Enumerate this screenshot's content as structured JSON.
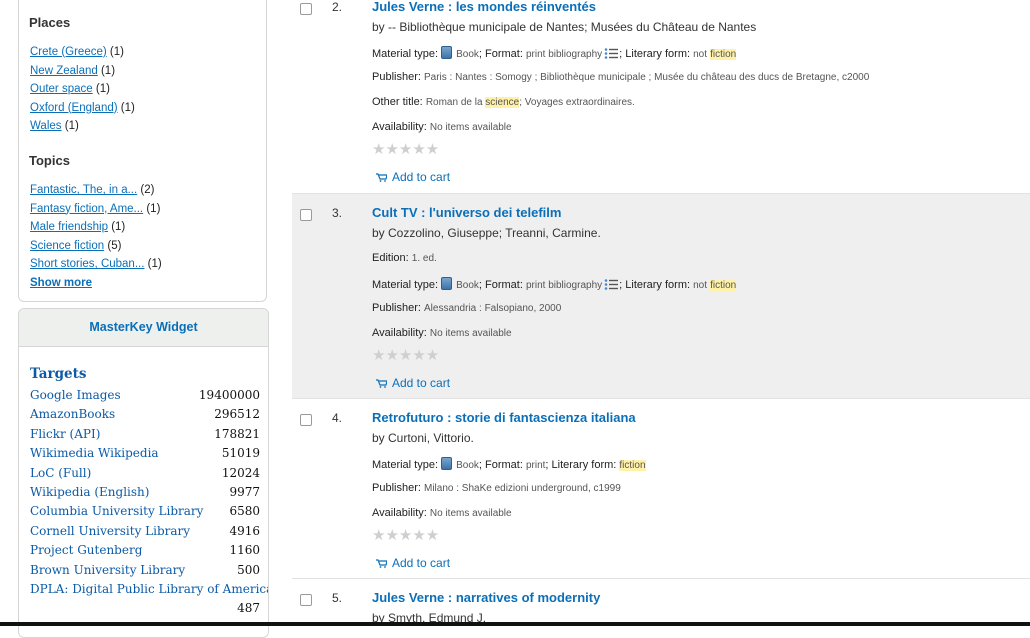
{
  "facets": {
    "places": {
      "title": "Places",
      "items": [
        {
          "label": "Crete (Greece)",
          "count": "(1)"
        },
        {
          "label": "New Zealand",
          "count": "(1)"
        },
        {
          "label": "Outer space",
          "count": "(1)"
        },
        {
          "label": "Oxford (England)",
          "count": "(1)"
        },
        {
          "label": "Wales",
          "count": "(1)"
        }
      ]
    },
    "topics": {
      "title": "Topics",
      "items": [
        {
          "label": "Fantastic, The, in a...",
          "count": "(2)"
        },
        {
          "label": "Fantasy fiction, Ame...",
          "count": "(1)"
        },
        {
          "label": "Male friendship",
          "count": "(1)"
        },
        {
          "label": "Science fiction",
          "count": "(5)"
        },
        {
          "label": "Short stories, Cuban...",
          "count": "(1)"
        }
      ],
      "show_more": "Show more"
    }
  },
  "masterkey": {
    "title": "MasterKey Widget",
    "targets_title": "Targets",
    "targets": [
      {
        "name": "Google Images",
        "count": "19400000"
      },
      {
        "name": "AmazonBooks",
        "count": "296512"
      },
      {
        "name": "Flickr (API)",
        "count": "178821"
      },
      {
        "name": "Wikimedia Wikipedia",
        "count": "51019"
      },
      {
        "name": "LoC (Full)",
        "count": "12024"
      },
      {
        "name": "Wikipedia (English)",
        "count": "9977"
      },
      {
        "name": "Columbia University Library",
        "count": "6580"
      },
      {
        "name": "Cornell University Library",
        "count": "4916"
      },
      {
        "name": "Project Gutenberg",
        "count": "1160"
      },
      {
        "name": "Brown University Library",
        "count": "500"
      },
      {
        "name": "DPLA: Digital Public Library of America",
        "count": "487"
      }
    ]
  },
  "labels": {
    "material_type": "Material type:",
    "book": "Book",
    "format": "; Format:",
    "literary_form": "; Literary form:",
    "publisher": "Publisher:",
    "other_title": "Other title:",
    "availability": "Availability:",
    "edition": "Edition:",
    "add_to_cart": "Add to cart",
    "not": "not",
    "stars": "★★★★★"
  },
  "results": [
    {
      "num": "2.",
      "title": "Jules Verne : les mondes réinventés",
      "by": "by -- Bibliothèque municipale de Nantes; Musées du Château de Nantes",
      "format": "print bibliography",
      "form_not": "not",
      "form": "fiction",
      "publisher": "Paris : Nantes : Somogy ; Bibliothèque municipale ; Musée du château des ducs de Bretagne, c2000",
      "other_title_pre": "Roman de la ",
      "other_title_hl": "science",
      "other_title_post": "; Voyages extraordinaires.",
      "availability": "No items available"
    },
    {
      "num": "3.",
      "title": "Cult TV : l'universo dei telefilm",
      "by": "by Cozzolino, Giuseppe; Treanni, Carmine.",
      "edition": "1. ed.",
      "format": "print bibliography",
      "form_not": "not",
      "form": "fiction",
      "publisher": "Alessandria : Falsopiano, 2000",
      "availability": "No items available"
    },
    {
      "num": "4.",
      "title": "Retrofuturo : storie di fantascienza italiana",
      "by": "by Curtoni, Vittorio.",
      "format": "print",
      "form": "fiction",
      "publisher": "Milano : ShaKe edizioni underground, c1999",
      "availability": "No items available"
    },
    {
      "num": "5.",
      "title": "Jules Verne : narratives of modernity",
      "by": "by Smyth, Edmund J."
    }
  ]
}
